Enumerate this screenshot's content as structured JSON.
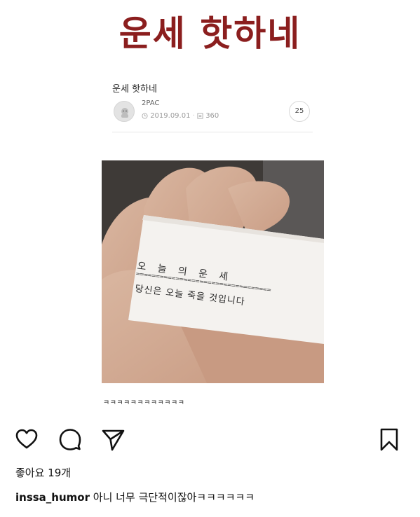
{
  "banner": {
    "title": "운세 핫하네"
  },
  "post": {
    "title": "운세 핫하네",
    "author": "2PAC",
    "date": "2019.09.01",
    "views": "360",
    "comment_count": "25"
  },
  "photo": {
    "receipt_header": "오 늘 의 운 세",
    "receipt_rule": "==================================",
    "receipt_message": "당신은 오늘 죽을 것입니다"
  },
  "post_caption": "ㅋㅋㅋㅋㅋㅋㅋㅋㅋㅋㅋㅋ",
  "instagram": {
    "likes": "좋아요 19개",
    "username": "inssa_humor",
    "caption_text": " 아니 너무 극단적이잖아ㅋㅋㅋㅋㅋㅋ"
  },
  "icons": {
    "like": "heart-icon",
    "comment": "comment-bubble-icon",
    "share": "paper-plane-icon",
    "save": "bookmark-icon"
  },
  "colors": {
    "banner": "#8b1e1e",
    "text": "#111111"
  }
}
